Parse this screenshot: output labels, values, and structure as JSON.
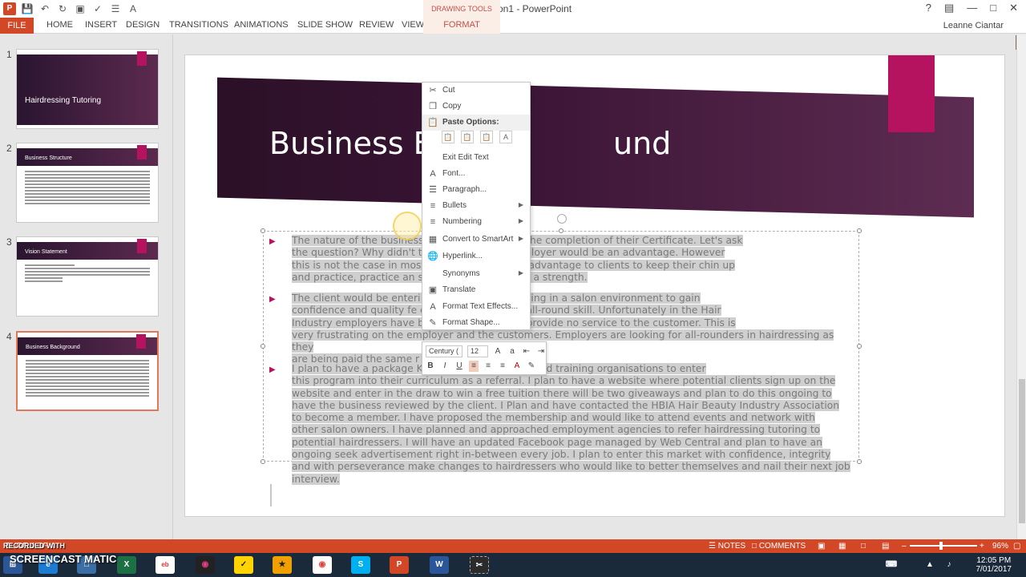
{
  "window": {
    "title": "Presentation1 - PowerPoint",
    "context_tab_group": "DRAWING TOOLS",
    "user": "Leanne Ciantar"
  },
  "ribbon": {
    "tabs": [
      "FILE",
      "HOME",
      "INSERT",
      "DESIGN",
      "TRANSITIONS",
      "ANIMATIONS",
      "SLIDE SHOW",
      "REVIEW",
      "VIEW",
      "FORMAT"
    ]
  },
  "slides": [
    {
      "number": "1",
      "title": "Hairdressing Tutoring"
    },
    {
      "number": "2",
      "title": "Business Structure"
    },
    {
      "number": "3",
      "title": "Vision Statement"
    },
    {
      "number": "4",
      "title": "Business Background"
    }
  ],
  "current_slide": {
    "title": "Business Background",
    "title_visible_left": "Business Ba",
    "title_visible_right": "und",
    "paragraphs": [
      {
        "lines": [
          "The nature of the business                                  to Hairdresser after the completion of their Certificate. Let's ask",
          "the question? Why didn't t                                   edback from the employer would be an advantage. However",
          "this is not the case in most                                ral this would be an advantage to clients to keep their chin up",
          "and practice, practice an                                   s and develop this into a strength."
        ]
      },
      {
        "lines": [
          "The client would be enteri                                  evelopment and working in a salon environment to gain",
          "confidence and quality fe                                   eir next employer an all-round skill. Unfortunately in the Hair",
          "Industry employers have b                                   ch weaknesses and provide no service to the customer. This is",
          "very frustrating on the employer and the customers. Employers are looking for all-rounders in hairdressing as they",
          "are being paid the same r                                          weaknesses."
        ]
      },
      {
        "lines": [
          "I plan to have a package                                          KETING to target registered training organisations to enter",
          "this program into their curriculum as a referral. I plan to have a website where potential clients sign up on the",
          "website and enter in the draw to win a free tuition there will be two giveaways and plan to do this ongoing to",
          "have the business reviewed by the client. I Plan and have contacted the HBIA Hair Beauty Industry Association",
          "to become a member. I have proposed the membership and would like to attend events and network with",
          "other salon owners. I have planned and approached employment agencies to refer hairdressing tutoring to",
          "potential hairdressers. I will have an updated Facebook page managed by Web Central and plan to have an",
          "ongoing seek advertisement right in-between every job. I plan to enter this market with confidence, integrity",
          "and with perseverance make changes to hairdressers who would like to better themselves and nail their next job",
          "interview."
        ]
      }
    ]
  },
  "context_menu": {
    "items": [
      {
        "label": "Cut",
        "icon": "scissors-icon"
      },
      {
        "label": "Copy",
        "icon": "copy-icon"
      },
      {
        "label": "Paste Options:",
        "icon": "paste-icon"
      },
      {
        "label": "Exit Edit Text",
        "icon": ""
      },
      {
        "label": "Font...",
        "icon": "font-icon"
      },
      {
        "label": "Paragraph...",
        "icon": "paragraph-icon"
      },
      {
        "label": "Bullets",
        "icon": "bullets-icon"
      },
      {
        "label": "Numbering",
        "icon": "numbering-icon"
      },
      {
        "label": "Convert to SmartArt",
        "icon": "smartart-icon"
      },
      {
        "label": "Hyperlink...",
        "icon": "hyperlink-icon"
      },
      {
        "label": "Synonyms",
        "icon": ""
      },
      {
        "label": "Translate",
        "icon": "translate-icon"
      },
      {
        "label": "Format Text Effects...",
        "icon": "text-effects-icon"
      },
      {
        "label": "Format Shape...",
        "icon": "format-shape-icon"
      }
    ]
  },
  "mini_toolbar": {
    "font": "Century (",
    "size": "12"
  },
  "statusbar": {
    "left": "SLIDE 4 OF 4",
    "notes": "NOTES",
    "comments": "COMMENTS",
    "zoom": "96%"
  },
  "watermark": {
    "recorded": "RECORDED WITH",
    "brand": "SCREENCAST  MATIC"
  },
  "taskbar": {
    "time": "12:05 PM",
    "date": "7/01/2017"
  },
  "colors": {
    "accent": "#d24726",
    "slide_accent": "#b5125f",
    "title_band": "#3b1536"
  }
}
